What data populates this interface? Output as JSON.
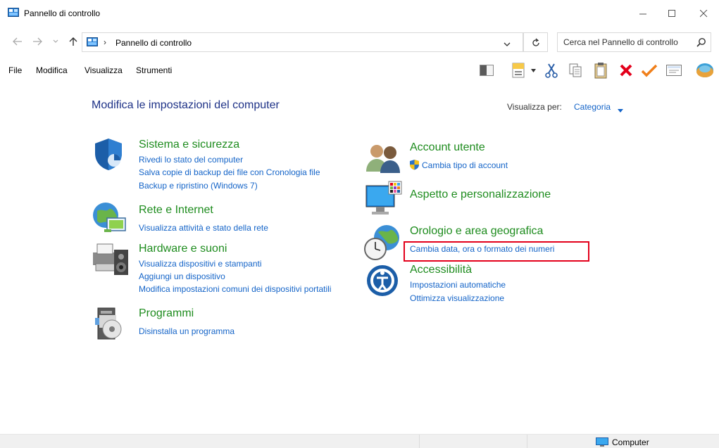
{
  "window": {
    "title": "Pannello di controllo"
  },
  "address": {
    "crumb": "Pannello di controllo",
    "search_placeholder": "Cerca nel Pannello di controllo"
  },
  "menu": [
    "File",
    "Modifica",
    "Visualizza",
    "Strumenti"
  ],
  "content": {
    "heading": "Modifica le impostazioni del computer",
    "view_by_label": "Visualizza per:",
    "view_by_value": "Categoria"
  },
  "categories": {
    "sistema": {
      "title": "Sistema e sicurezza",
      "links": [
        "Rivedi lo stato del computer",
        "Salva copie di backup dei file con Cronologia file",
        "Backup e ripristino (Windows 7)"
      ]
    },
    "rete": {
      "title": "Rete e Internet",
      "links": [
        "Visualizza attività e stato della rete"
      ]
    },
    "hardware": {
      "title": "Hardware e suoni",
      "links": [
        "Visualizza dispositivi e stampanti",
        "Aggiungi un dispositivo",
        "Modifica impostazioni comuni dei dispositivi portatili"
      ]
    },
    "programmi": {
      "title": "Programmi",
      "links": [
        "Disinstalla un programma"
      ]
    },
    "account": {
      "title": "Account utente",
      "links": [
        "Cambia tipo di account"
      ]
    },
    "aspetto": {
      "title": "Aspetto e personalizzazione",
      "links": []
    },
    "orologio": {
      "title": "Orologio e area geografica",
      "links": [
        "Cambia data, ora o formato dei numeri"
      ]
    },
    "accessibilita": {
      "title": "Accessibilità",
      "links": [
        "Impostazioni automatiche",
        "Ottimizza visualizzazione"
      ]
    }
  },
  "status": {
    "location": "Computer"
  },
  "colors": {
    "link": "#1464c8",
    "category_title": "#1e8c1e",
    "heading": "#1e3287",
    "highlight": "#e3001b"
  }
}
